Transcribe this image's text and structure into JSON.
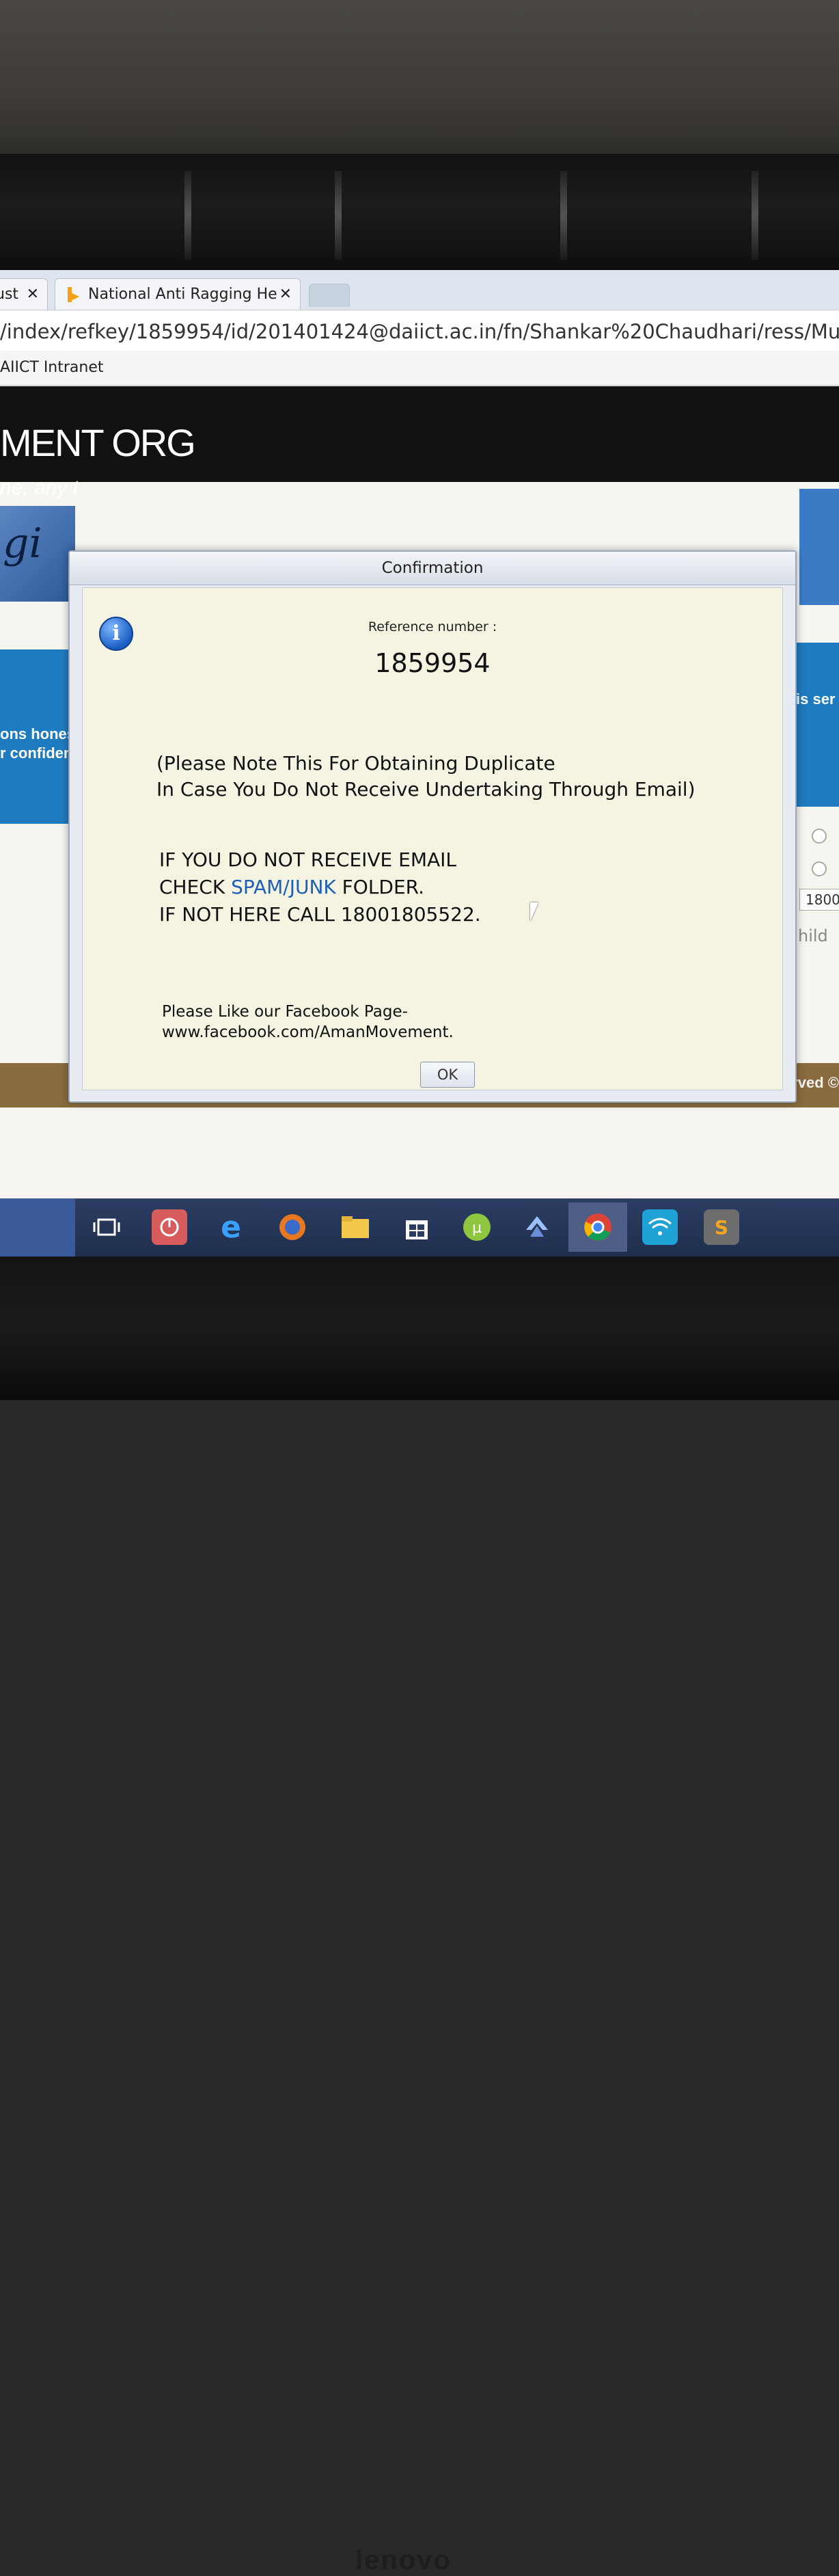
{
  "browser": {
    "tabs": [
      {
        "label": "ust",
        "close": "✕"
      },
      {
        "label": "National Anti Ragging He",
        "close": "✕"
      }
    ],
    "url": "/index/refkey/1859954/id/201401424@daiict.ac.in/fn/Shankar%20Chaudhari/ress/Mumbai/",
    "bookmark": "AIICT Intranet"
  },
  "site": {
    "title": "MENT ORG",
    "tagline": "ne, any t",
    "left_panel_text_1": "ons hones",
    "left_panel_text_2": "r confiden",
    "right_panel_text": "is ser",
    "phone_fragment": "1800",
    "child_fragment": "hild",
    "footer": "All rights reserved ©"
  },
  "dialog": {
    "title": "Confirmation",
    "reference_label": "Reference number :",
    "reference_number": "1859954",
    "note_line1": "(Please Note This For Obtaining Duplicate",
    "note_line2": "In Case You Do Not Receive Undertaking Through Email)",
    "warn_line1": "IF YOU DO NOT RECEIVE EMAIL",
    "warn_line2_pre": "CHECK ",
    "warn_line2_link": "SPAM/JUNK",
    "warn_line2_post": " FOLDER.",
    "warn_line3": "IF NOT HERE CALL 18001805522.",
    "fb_line1": "Please Like our Facebook Page-",
    "fb_line2": "www.facebook.com/AmanMovement.",
    "ok_label": "OK"
  },
  "taskbar": {
    "icons": [
      "task-view-icon",
      "power-app-icon",
      "edge-icon",
      "firefox-icon",
      "file-explorer-icon",
      "store-icon",
      "utorrent-icon",
      "app-arrow-icon",
      "chrome-icon",
      "wifi-icon",
      "sublime-icon"
    ]
  },
  "device": {
    "brand": "lenovo"
  }
}
